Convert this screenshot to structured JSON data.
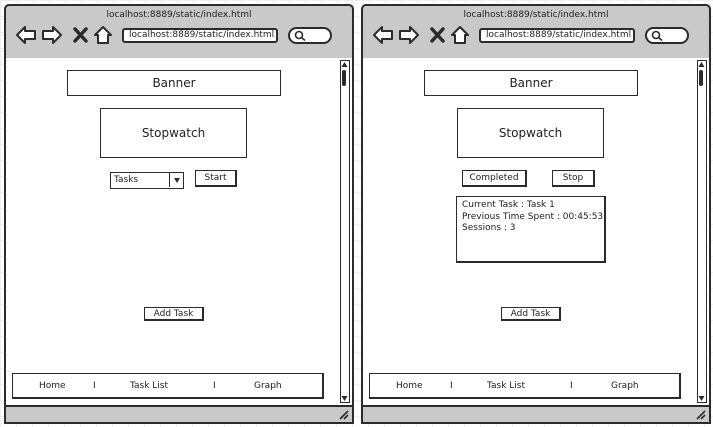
{
  "browser_left": {
    "page_url_title": "localhost:8889/static/index.html",
    "address_bar_value": "localhost:8889/static/index.html",
    "banner": "Banner",
    "stopwatch": "Stopwatch",
    "task_select_value": "Tasks",
    "start_button": "Start",
    "add_task_button": "Add Task",
    "footer": {
      "home": "Home",
      "separator_1": "I",
      "task_list": "Task List",
      "separator_2": "I",
      "graph": "Graph"
    }
  },
  "browser_right": {
    "page_url_title": "localhost:8889/static/index.html",
    "address_bar_value": "localhost:8889/static/index.html",
    "banner": "Banner",
    "stopwatch": "Stopwatch",
    "completed_button": "Completed",
    "stop_button": "Stop",
    "info": {
      "current_task": "Current Task : Task 1",
      "previous_time": "Previous Time Spent : 00:45:53",
      "sessions": "Sessions : 3"
    },
    "add_task_button": "Add Task",
    "footer": {
      "home": "Home",
      "separator_1": "I",
      "task_list": "Task List",
      "separator_2": "I",
      "graph": "Graph"
    }
  },
  "icons": [
    "back-arrow-icon",
    "forward-arrow-icon",
    "close-icon",
    "home-icon",
    "search-icon",
    "chevron-down-icon",
    "resize-grip-icon"
  ]
}
